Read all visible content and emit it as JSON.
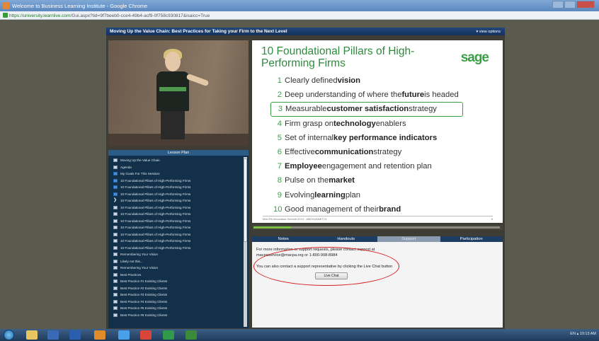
{
  "browser": {
    "window_title": "Welcome to Business Learning Institute - Google Chrome",
    "url_host": "https://university.learnlive.com",
    "url_path": "/Gui.aspx?tid=9f7beeb0-cce4-49b4-acf9-0f758c930817&isaicc=True"
  },
  "player": {
    "course_title": "Moving Up the Value Chain: Best Practices for Taking your Firm to the Next Level",
    "view_options": "▾ view options"
  },
  "lesson_plan": {
    "header": "Lesson Plan",
    "items": [
      {
        "label": "Moving Up the Value Chain."
      },
      {
        "label": "Agenda"
      },
      {
        "label": "My Goals For This Session:"
      },
      {
        "label": "10 Foundational Pillars of High-Performing Firms"
      },
      {
        "label": "10 Foundational Pillars of High-Performing Firms"
      },
      {
        "label": "10 Foundational Pillars of High-Performing Firms"
      },
      {
        "label": "10 Foundational Pillars of High-Performing Firms"
      },
      {
        "label": "10 Foundational Pillars of High-Performing Firms"
      },
      {
        "label": "10 Foundational Pillars of High-Performing Firms"
      },
      {
        "label": "10 Foundational Pillars of High-Performing Firms"
      },
      {
        "label": "10 Foundational Pillars of High-Performing Firms"
      },
      {
        "label": "10 Foundational Pillars of High-Performing Firms"
      },
      {
        "label": "10 Foundational Pillars of High-Performing Firms"
      },
      {
        "label": "10 Foundational Pillars of High-Performing Firms"
      },
      {
        "label": "Remembering Your Vision"
      },
      {
        "label": "Likely not this..."
      },
      {
        "label": "Remembering Your Vision"
      },
      {
        "label": "Best Practices"
      },
      {
        "label": "Best Practice #1 Existing Clients"
      },
      {
        "label": "Best Practice #2 Existing Clients"
      },
      {
        "label": "Best Practice #3 Existing Clients"
      },
      {
        "label": "Best Practice #4 Existing Clients"
      },
      {
        "label": "Best Practice #5 Existing Clients"
      },
      {
        "label": "Best Practice #6 Existing Clients"
      }
    ]
  },
  "slide": {
    "title": "10 Foundational Pillars of High-Performing Firms",
    "logo": "sage",
    "pillars": [
      {
        "n": "1",
        "pre": "Clearly defined ",
        "bold": "vision",
        "post": ""
      },
      {
        "n": "2",
        "pre": "Deep understanding of where the ",
        "bold": "future",
        "post": " is headed"
      },
      {
        "n": "3",
        "pre": "Measurable ",
        "bold": "customer satisfaction",
        "post": " strategy"
      },
      {
        "n": "4",
        "pre": "Firm grasp on ",
        "bold": "technology",
        "post": " enablers"
      },
      {
        "n": "5",
        "pre": "Set of internal ",
        "bold": "key performance indicators",
        "post": ""
      },
      {
        "n": "6",
        "pre": "Effective ",
        "bold": "communication",
        "post": " strategy"
      },
      {
        "n": "7",
        "pre": "",
        "bold": "Employee",
        "post": " engagement and retention plan"
      },
      {
        "n": "8",
        "pre": "Pulse on the ",
        "bold": "market",
        "post": ""
      },
      {
        "n": "9",
        "pre": "Evolving ",
        "bold": "learning",
        "post": " plan"
      },
      {
        "n": "10",
        "pre": "Good management of their ",
        "bold": "brand",
        "post": ""
      }
    ],
    "footer": "MACPA Innovation Summit 2013 · #MDSUMMIT13",
    "page": "6"
  },
  "progress": {
    "fraction": 0.15
  },
  "tabs": [
    "Notes",
    "Handouts",
    "Support",
    "Participation"
  ],
  "support": {
    "p1": "For more information or support requests, please contact support at macpaservice@macpa.org or 1-800-908-8984",
    "p2": "You can also contact a support representative by clicking the Live Chat button",
    "live_chat": "Live Chat"
  },
  "taskbar": {
    "tray": "EN  ▴  10:13 AM"
  }
}
